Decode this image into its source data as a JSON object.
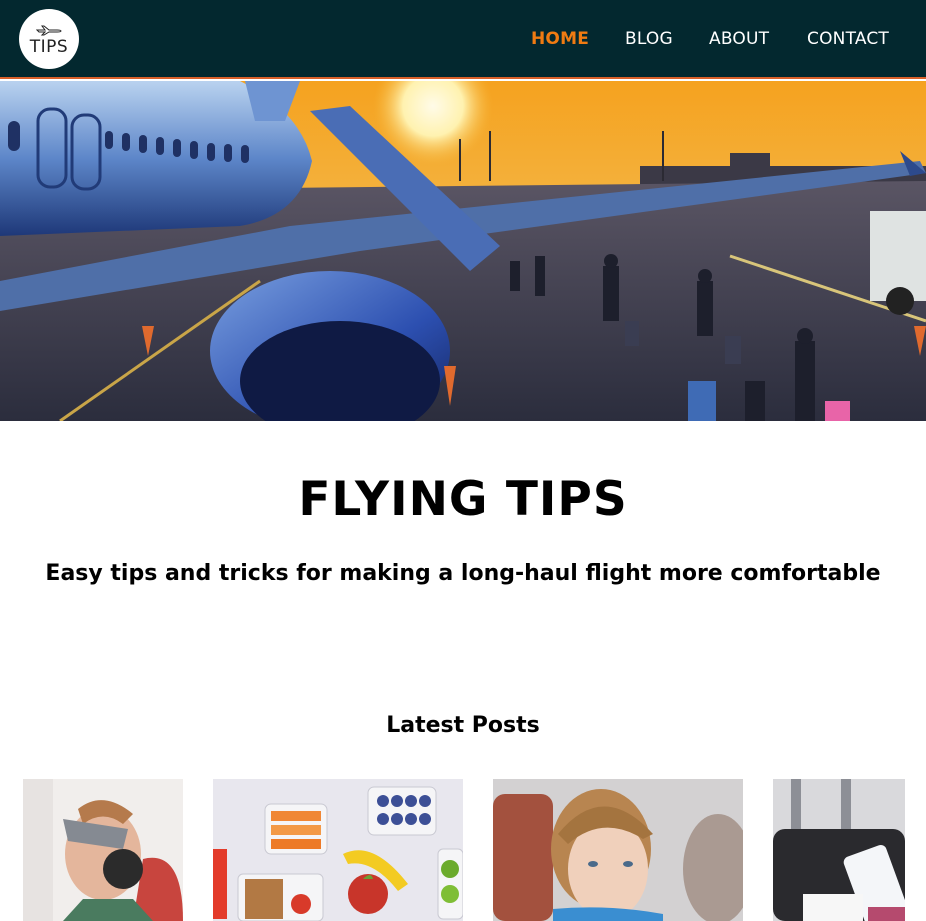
{
  "header": {
    "logo_text": "TIPS",
    "logo_icon": "airplane-icon",
    "nav": {
      "home": "HOME",
      "blog": "BLOG",
      "about": "ABOUT",
      "contact": "CONTACT"
    },
    "active_item": "HOME"
  },
  "main": {
    "title": "FLYING TIPS",
    "subtitle": "Easy tips and tricks for making a long-haul flight more comfortable",
    "latest_heading": "Latest Posts"
  },
  "colors": {
    "header_bg": "#03282f",
    "accent": "#f07b12",
    "header_border": "#d9602a"
  }
}
